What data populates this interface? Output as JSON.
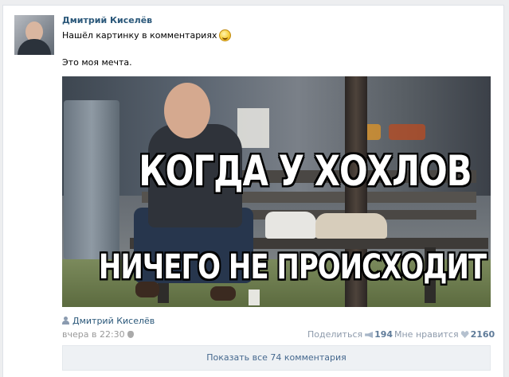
{
  "post": {
    "author": "Дмитрий Киселёв",
    "text_line1": "Нашёл картинку в комментариях",
    "emoji": "smile-emoji",
    "text_line2": "Это моя мечта.",
    "image": {
      "caption_top": "КОГДА У ХОХЛОВ",
      "caption_bottom": "НИЧЕГО НЕ ПРОИСХОДИТ"
    },
    "signer": "Дмитрий Киселёв",
    "date": "вчера в 22:30",
    "share_label": "Поделиться",
    "share_count": "194",
    "like_label": "Мне нравится",
    "like_count": "2160",
    "comments_button": "Показать все 74 комментария"
  },
  "colors": {
    "link": "#2b587a",
    "background": "#edeef0",
    "muted": "#999999"
  }
}
